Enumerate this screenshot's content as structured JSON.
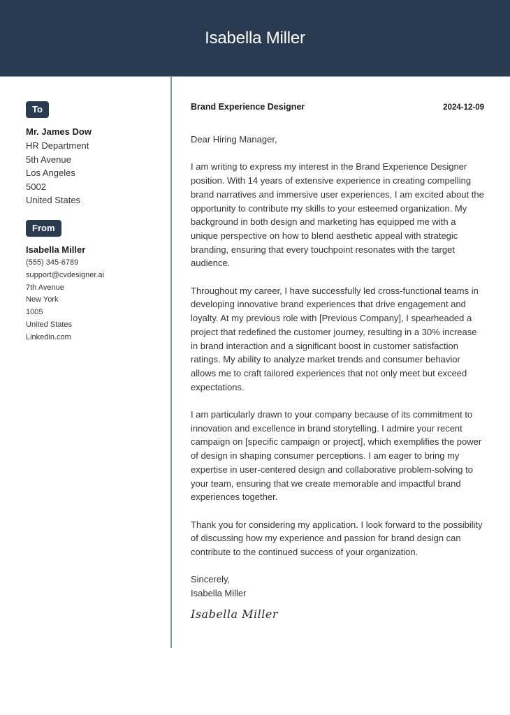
{
  "header": {
    "name": "Isabella Miller"
  },
  "sidebar": {
    "to": {
      "badge": "To",
      "name": "Mr. James Dow",
      "lines": [
        "HR Department",
        "5th Avenue",
        "Los Angeles",
        "5002",
        "United States"
      ]
    },
    "from": {
      "badge": "From",
      "name": "Isabella Miller",
      "lines": [
        "(555) 345-6789",
        "support@cvdesigner.ai",
        "7th Avenue",
        "New York",
        "1005",
        "United States",
        "Linkedin.com"
      ]
    }
  },
  "letter": {
    "job_title": "Brand Experience Designer",
    "date": "2024-12-09",
    "salutation": "Dear Hiring Manager,",
    "paragraphs": [
      "I am writing to express my interest in the Brand Experience Designer position. With 14 years of extensive experience in creating compelling brand narratives and immersive user experiences, I am excited about the opportunity to contribute my skills to your esteemed organization. My background in both design and marketing has equipped me with a unique perspective on how to blend aesthetic appeal with strategic branding, ensuring that every touchpoint resonates with the target audience.",
      "Throughout my career, I have successfully led cross-functional teams in developing innovative brand experiences that drive engagement and loyalty. At my previous role with [Previous Company], I spearheaded a project that redefined the customer journey, resulting in a 30% increase in brand interaction and a significant boost in customer satisfaction ratings. My ability to analyze market trends and consumer behavior allows me to craft tailored experiences that not only meet but exceed expectations.",
      "I am particularly drawn to your company because of its commitment to innovation and excellence in brand storytelling. I admire your recent campaign on [specific campaign or project], which exemplifies the power of design in shaping consumer perceptions. I am eager to bring my expertise in user-centered design and collaborative problem-solving to your team, ensuring that we create memorable and impactful brand experiences together.",
      "Thank you for considering my application. I look forward to the possibility of discussing how my experience and passion for brand design can contribute to the continued success of your organization."
    ],
    "closing": "Sincerely,",
    "closing_name": "Isabella Miller",
    "signature": "Isabella Miller"
  }
}
